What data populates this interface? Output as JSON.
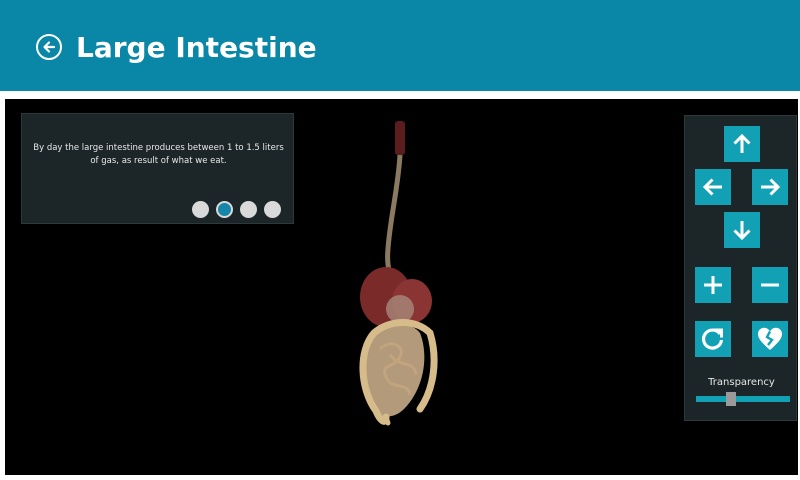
{
  "header": {
    "title": "Large Intestine",
    "background_color": "#0a87a7",
    "back_icon": "arrow-left-circle-icon"
  },
  "info_panel": {
    "fact_text": "By day the large intestine produces between 1 to 1.5 liters of gas, as result of what we eat.",
    "pager": {
      "total": 4,
      "active_index": 1
    }
  },
  "controls": {
    "accent_color": "#12a0b5",
    "buttons": [
      "arrow-up-icon",
      "arrow-left-icon",
      "arrow-right-icon",
      "arrow-down-icon",
      "plus-icon",
      "minus-icon",
      "reset-rotate-icon",
      "broken-heart-icon"
    ],
    "transparency_label": "Transparency",
    "transparency_value": 0.37
  }
}
